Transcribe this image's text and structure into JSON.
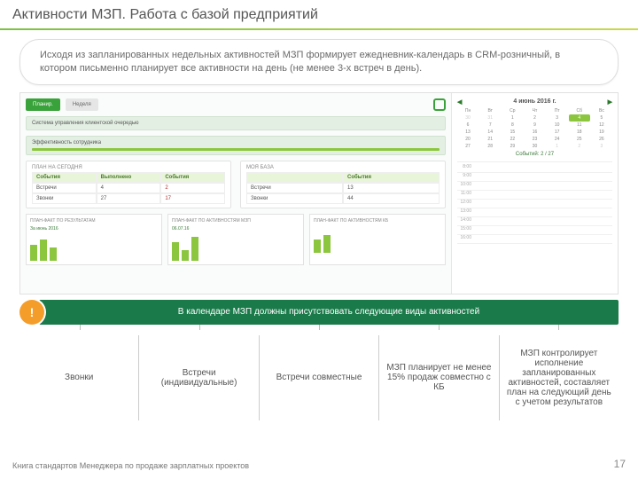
{
  "title": "Активности МЗП. Работа с базой предприятий",
  "callout": "Исходя из запланированных недельных активностей МЗП формирует ежедневник-календарь в CRM-розничный, в котором письменно планирует все активности на день (не менее 3-х встреч в день).",
  "crm": {
    "btn_plan": "Планир.",
    "btn_week": "Неделя",
    "panel1": "Система управления клиентской очередью",
    "panel2": "Эффективность сотрудника",
    "today_label": "ПЛАН НА СЕГОДНЯ",
    "base_label": "МОЯ БАЗА",
    "col_events": "События",
    "col_done": "Выполнено",
    "col_count": "События",
    "row_meet": "Встречи",
    "row_call": "Звонки",
    "meet_plan": "4",
    "meet_done": "2",
    "call_plan": "27",
    "call_done": "17",
    "base_meet": "13",
    "base_call": "44",
    "plan_results": "ПЛАН-ФАКТ ПО РЕЗУЛЬТАТАМ",
    "plan_activities": "ПЛАН-ФАКТ ПО АКТИВНОСТЯМ МЗП",
    "plan_activities_kb": "ПЛАН-ФАКТ ПО АКТИВНОСТЯМ КБ",
    "chart_month": "За июнь 2016",
    "chart_date": "06.07.16",
    "cal_month": "4 июнь 2016 г.",
    "cal_foot": "Событий: 2 / 27",
    "days": [
      "Пн",
      "Вт",
      "Ср",
      "Чт",
      "Пт",
      "Сб",
      "Вс"
    ]
  },
  "strip": {
    "excl": "!",
    "text": "В календаре МЗП должны присутствовать следующие виды активностей"
  },
  "boxes": {
    "b1": "Звонки",
    "b2": "Встречи (индивидуальные)",
    "b3": "Встречи совместные",
    "b4": "МЗП планирует не менее 15% продаж совместно с КБ",
    "b5": "МЗП контролирует исполнение запланированных активностей, составляет план на следующий день с учетом результатов"
  },
  "footer": "Книга стандартов Менеджера по продаже зарплатных проектов",
  "page": "17"
}
